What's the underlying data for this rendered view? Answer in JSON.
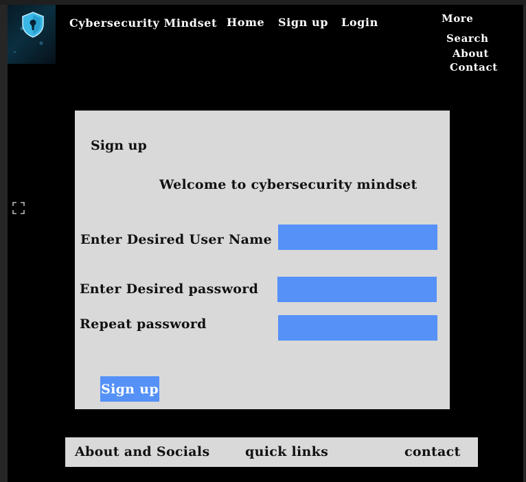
{
  "header": {
    "brand": "Cybersecurity Mindset",
    "nav": {
      "home": "Home",
      "signup": "Sign up",
      "login": "Login"
    },
    "more": {
      "title": "More",
      "items": [
        "Search",
        "About",
        "Contact"
      ]
    }
  },
  "form": {
    "title": "Sign up",
    "welcome": "Welcome to cybersecurity mindset",
    "username_label": "Enter Desired User Name",
    "username_value": "",
    "password_label": "Enter Desired password",
    "password_value": "",
    "repeat_label": "Repeat password",
    "repeat_value": "",
    "submit_label": "Sign up"
  },
  "footer": {
    "about": "About and Socials",
    "quick_links": "quick links",
    "contact": "contact"
  },
  "colors": {
    "background": "#000000",
    "panel": "#d9d9d9",
    "accent": "#5591f7",
    "logo": "#3bb7e6"
  },
  "icons": {
    "logo": "shield-lock-icon",
    "expand": "expand-icon"
  }
}
